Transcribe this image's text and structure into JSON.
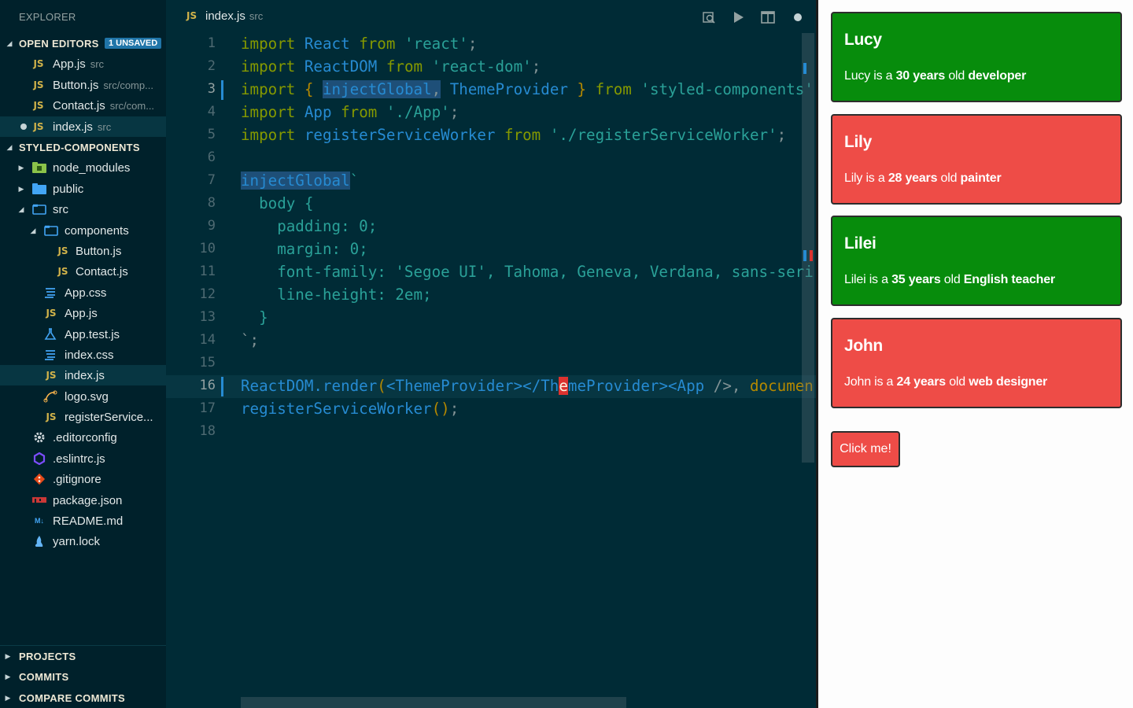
{
  "sidebar": {
    "title": "EXPLORER",
    "open_editors": {
      "label": "OPEN EDITORS",
      "badge": "1 UNSAVED",
      "files": [
        {
          "name": "App.js",
          "path": "src"
        },
        {
          "name": "Button.js",
          "path": "src/comp..."
        },
        {
          "name": "Contact.js",
          "path": "src/com..."
        },
        {
          "name": "index.js",
          "path": "src"
        }
      ]
    },
    "project": {
      "label": "STYLED-COMPONENTS",
      "items": [
        "node_modules",
        "public",
        "src",
        "components",
        "Button.js",
        "Contact.js",
        "App.css",
        "App.js",
        "App.test.js",
        "index.css",
        "index.js",
        "logo.svg",
        "registerService...",
        ".editorconfig",
        ".eslintrc.js",
        ".gitignore",
        "package.json",
        "README.md",
        "yarn.lock"
      ]
    },
    "bottom_sections": [
      "PROJECTS",
      "COMMITS",
      "COMPARE COMMITS"
    ]
  },
  "editor": {
    "tab": {
      "name": "index.js",
      "path": "src",
      "icon": "JS"
    },
    "lines": [
      {
        "n": "1"
      },
      {
        "n": "2"
      },
      {
        "n": "3"
      },
      {
        "n": "4"
      },
      {
        "n": "5"
      },
      {
        "n": "6"
      },
      {
        "n": "7"
      },
      {
        "n": "8"
      },
      {
        "n": "9"
      },
      {
        "n": "10"
      },
      {
        "n": "11"
      },
      {
        "n": "12"
      },
      {
        "n": "13"
      },
      {
        "n": "14"
      },
      {
        "n": "15"
      },
      {
        "n": "16"
      },
      {
        "n": "17"
      },
      {
        "n": "18"
      }
    ],
    "code": {
      "l1": [
        "import",
        "React",
        "from",
        "'react'",
        ";"
      ],
      "l2": [
        "import",
        "ReactDOM",
        "from",
        "'react-dom'",
        ";"
      ],
      "l3": [
        "import",
        "{",
        "injectGlobal",
        ",",
        "ThemeProvider",
        "}",
        "from",
        "'styled-components'"
      ],
      "l4": [
        "import",
        "App",
        "from",
        "'./App'",
        ";"
      ],
      "l5": [
        "import",
        "registerServiceWorker",
        "from",
        "'./registerServiceWorker'",
        ";"
      ],
      "l7": [
        "injectGlobal",
        "`"
      ],
      "l8": "  body {",
      "l9": "    padding: 0;",
      "l10": "    margin: 0;",
      "l11": "    font-family: 'Segoe UI', Tahoma, Geneva, Verdana, sans-seri",
      "l12": "    line-height: 2em;",
      "l13": "  }",
      "l14": "`;",
      "l16": [
        "ReactDOM",
        ".render",
        "(",
        "<ThemeProvider></Th",
        "e",
        "meProvider>",
        "<App",
        " />",
        ",",
        " documen"
      ],
      "l17": [
        "registerServiceWorker",
        "()",
        ";"
      ]
    }
  },
  "preview": {
    "cards": [
      {
        "name": "Lucy",
        "lead": "Lucy is a",
        "age": "30 years",
        "mid": "old",
        "job": "developer",
        "color": "#078c0c"
      },
      {
        "name": "Lily",
        "lead": "Lily is a",
        "age": "28 years",
        "mid": "old",
        "job": "painter",
        "color": "#ee4c47"
      },
      {
        "name": "Lilei",
        "lead": "Lilei is a",
        "age": "35 years",
        "mid": "old",
        "job": "English teacher",
        "color": "#078c0c"
      },
      {
        "name": "John",
        "lead": "John is a",
        "age": "24 years",
        "mid": "old",
        "job": "web designer",
        "color": "#ee4c47"
      }
    ],
    "button_label": "Click me!"
  }
}
